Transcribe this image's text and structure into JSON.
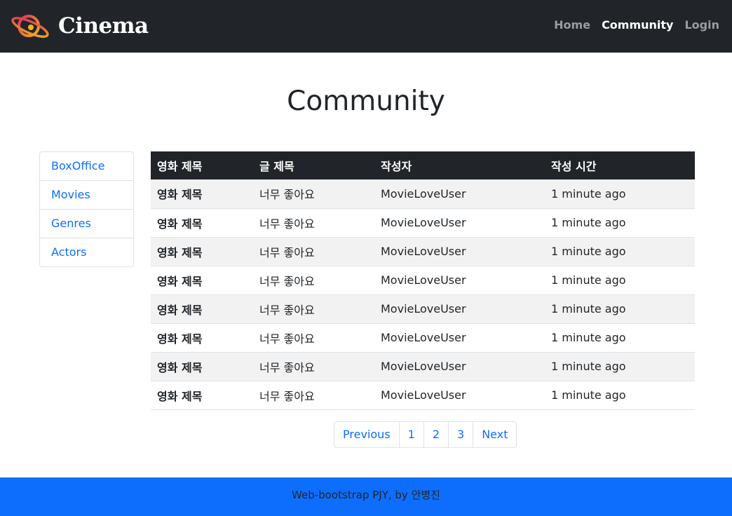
{
  "navbar": {
    "brand": "Cinema",
    "links": [
      {
        "label": "Home",
        "active": false
      },
      {
        "label": "Community",
        "active": true
      },
      {
        "label": "Login",
        "active": false
      }
    ]
  },
  "page_title": "Community",
  "sidebar": {
    "items": [
      {
        "label": "BoxOffice"
      },
      {
        "label": "Movies"
      },
      {
        "label": "Genres"
      },
      {
        "label": "Actors"
      }
    ]
  },
  "table": {
    "headers": [
      "영화 제목",
      "글 제목",
      "작성자",
      "작성 시간"
    ],
    "rows": [
      {
        "movie": "영화 제목",
        "title": "너무 좋아요",
        "author": "MovieLoveUser",
        "time": "1 minute ago"
      },
      {
        "movie": "영화 제목",
        "title": "너무 좋아요",
        "author": "MovieLoveUser",
        "time": "1 minute ago"
      },
      {
        "movie": "영화 제목",
        "title": "너무 좋아요",
        "author": "MovieLoveUser",
        "time": "1 minute ago"
      },
      {
        "movie": "영화 제목",
        "title": "너무 좋아요",
        "author": "MovieLoveUser",
        "time": "1 minute ago"
      },
      {
        "movie": "영화 제목",
        "title": "너무 좋아요",
        "author": "MovieLoveUser",
        "time": "1 minute ago"
      },
      {
        "movie": "영화 제목",
        "title": "너무 좋아요",
        "author": "MovieLoveUser",
        "time": "1 minute ago"
      },
      {
        "movie": "영화 제목",
        "title": "너무 좋아요",
        "author": "MovieLoveUser",
        "time": "1 minute ago"
      },
      {
        "movie": "영화 제목",
        "title": "너무 좋아요",
        "author": "MovieLoveUser",
        "time": "1 minute ago"
      }
    ]
  },
  "pagination": {
    "previous": "Previous",
    "pages": [
      "1",
      "2",
      "3"
    ],
    "next": "Next"
  },
  "footer": {
    "text": "Web-bootstrap PJY, by 안병진"
  },
  "colors": {
    "navbar_bg": "#212529",
    "accent": "#0d6efd",
    "footer_bg": "#0d6efd"
  },
  "icons": {
    "brand_logo": "planet-logo-icon"
  }
}
